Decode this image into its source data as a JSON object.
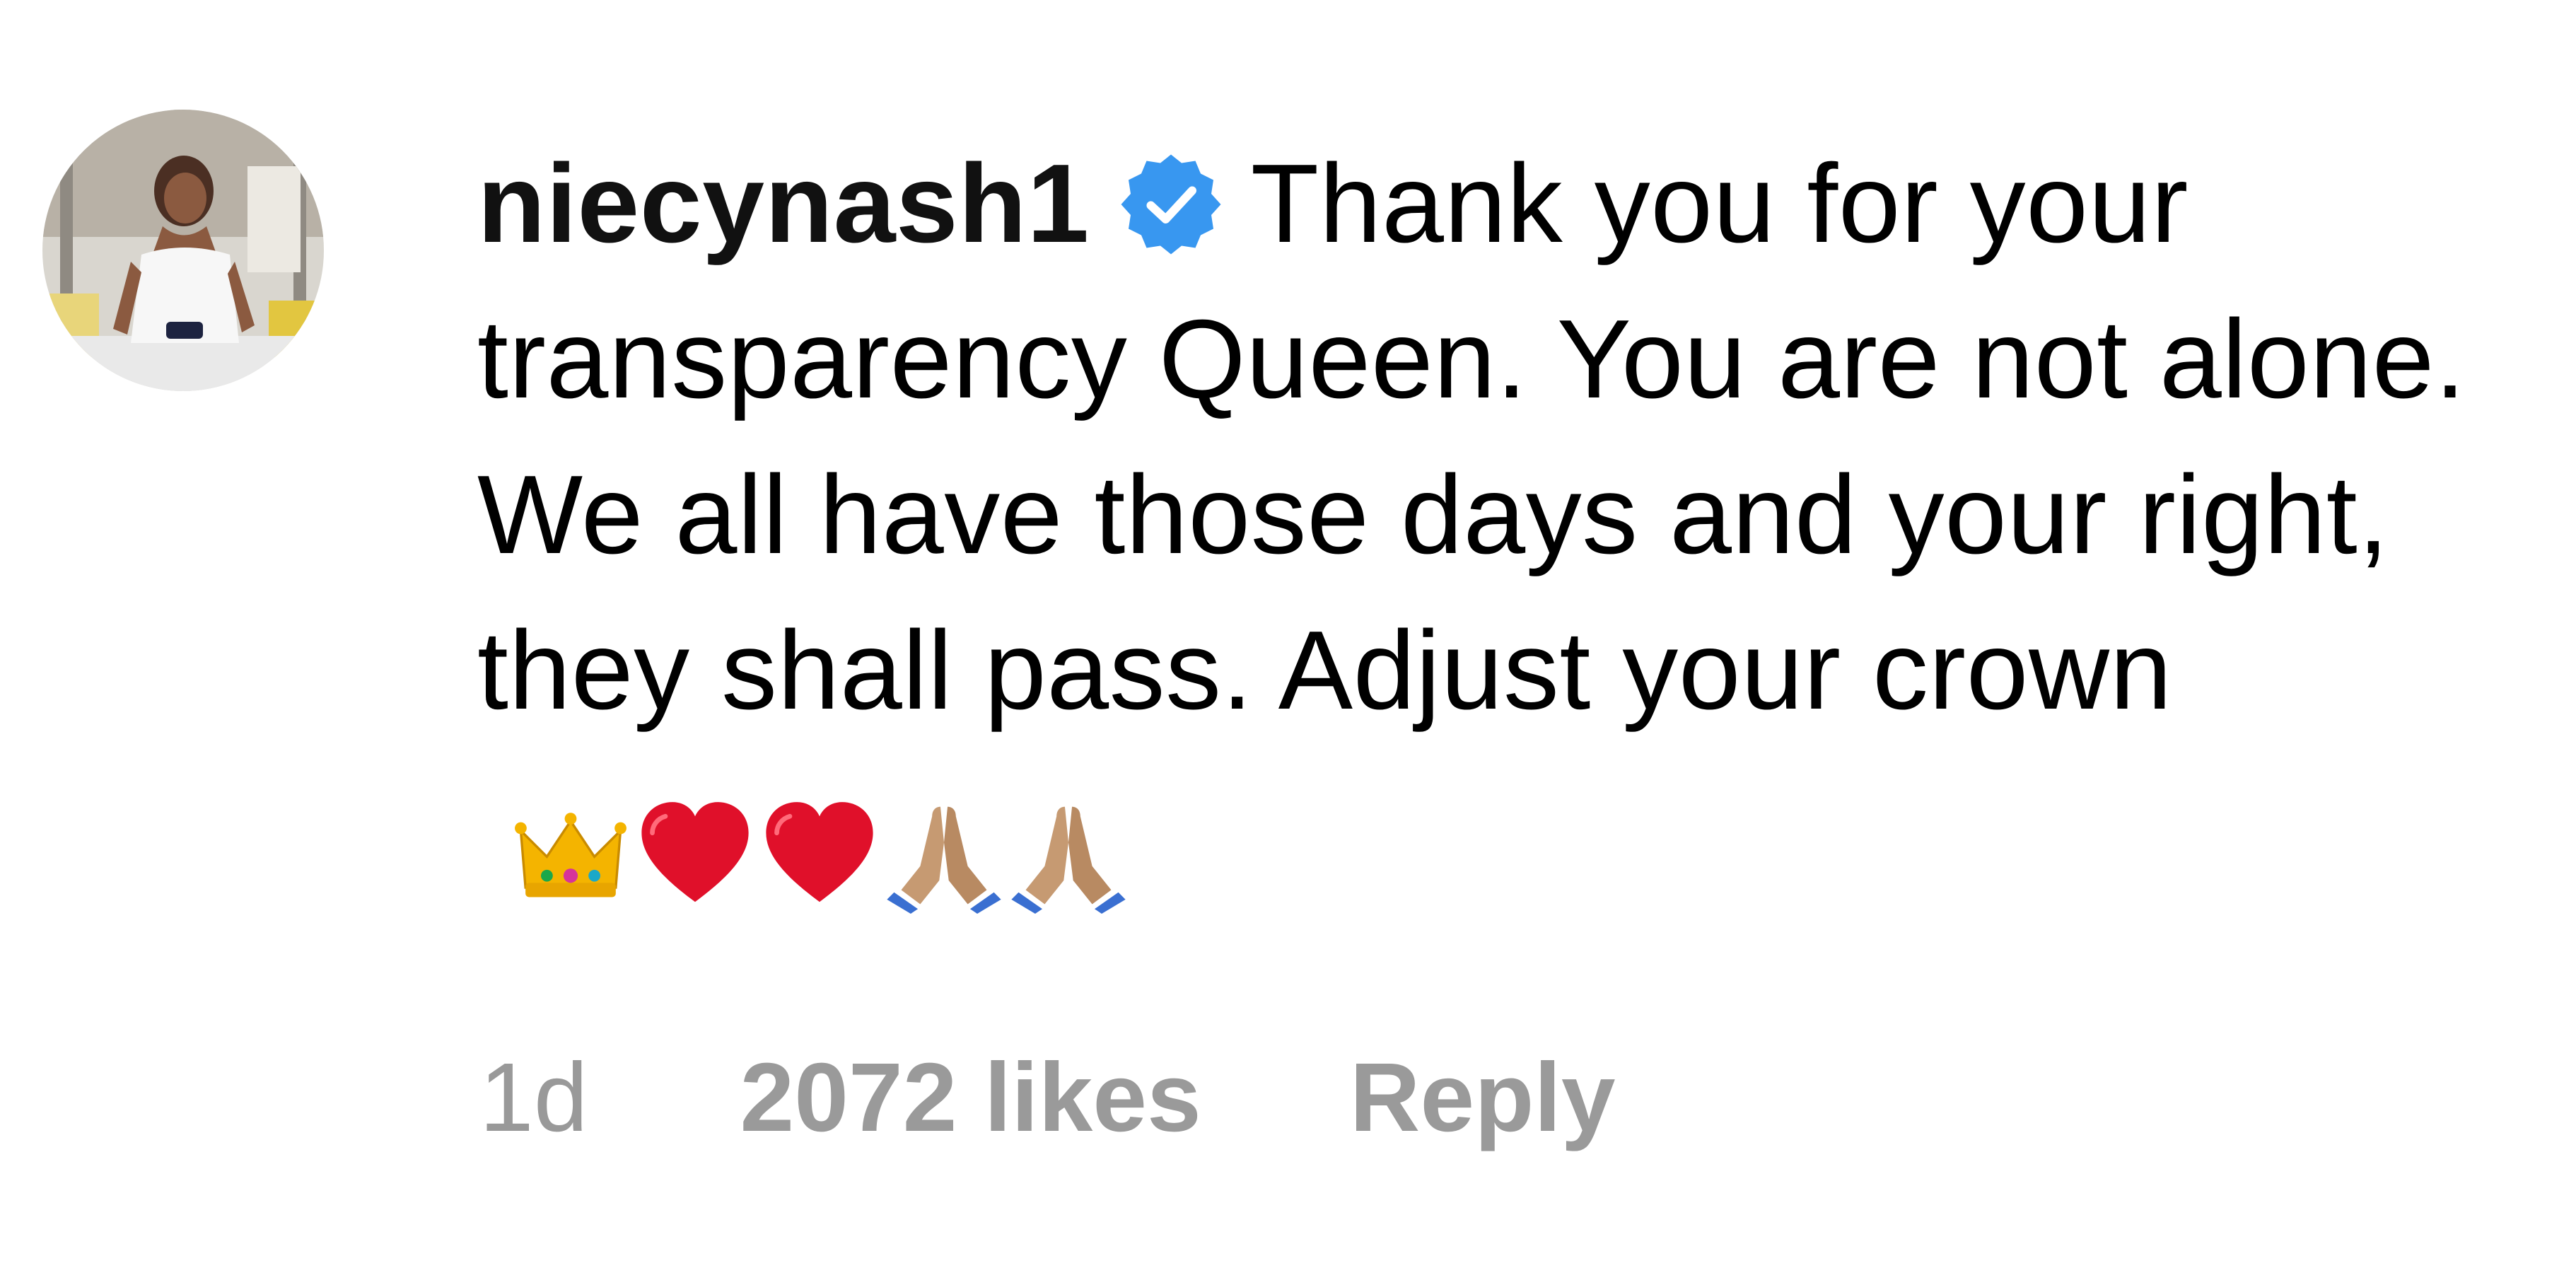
{
  "comment": {
    "username": "niecynash1",
    "verified": true,
    "text": "Thank you for your transparency Queen. You are not alone. We all have those days and your right, they shall pass. Adjust your crown",
    "emojis": [
      "crown-emoji",
      "red-heart-emoji",
      "red-heart-emoji",
      "folded-hands-emoji",
      "folded-hands-emoji"
    ],
    "time": "1d",
    "likes": "2072 likes",
    "reply_label": "Reply"
  },
  "colors": {
    "verified_blue": "#3897f0",
    "meta_gray": "#999999",
    "text": "#000000",
    "heart_red": "#e0102a",
    "crown_gold": "#f4b400"
  }
}
